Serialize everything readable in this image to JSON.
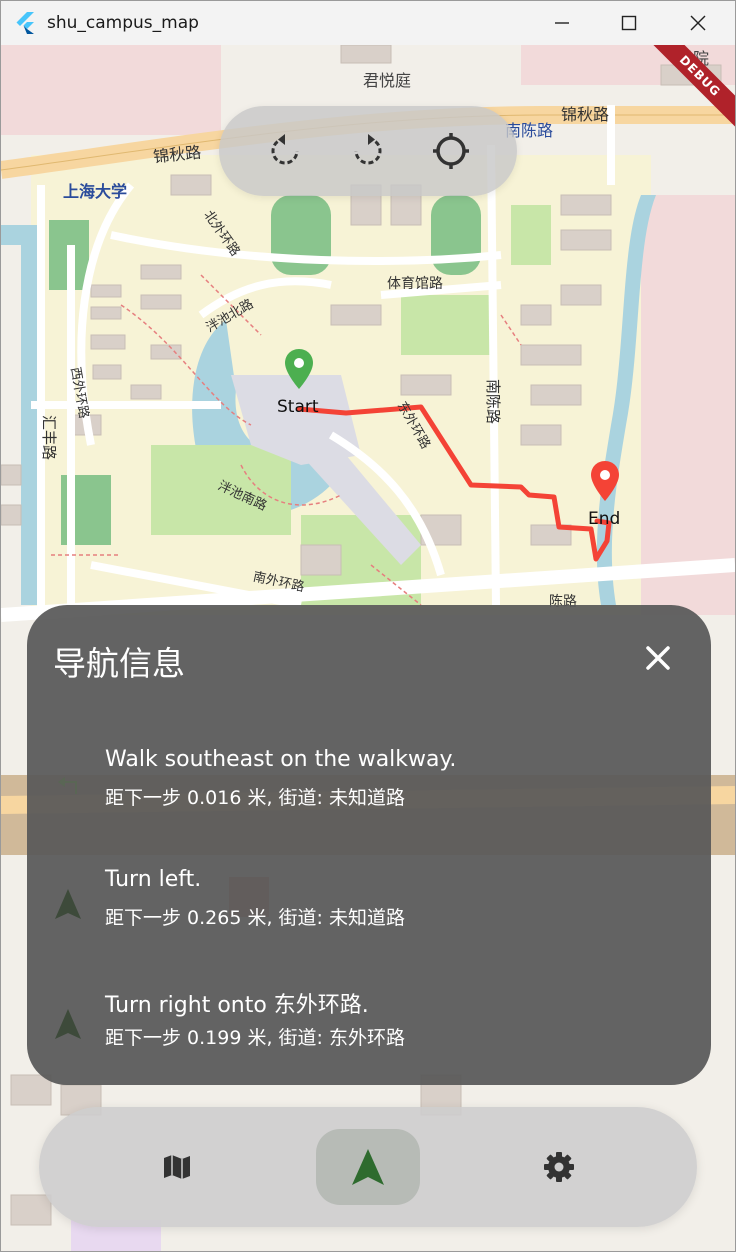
{
  "window": {
    "title": "shu_campus_map",
    "controls": [
      "minimize",
      "maximize",
      "close"
    ]
  },
  "debug_banner": "DEBUG",
  "map": {
    "start_label": "Start",
    "end_label": "End",
    "place_labels": [
      {
        "text": "君悦庭",
        "color": "#444444"
      },
      {
        "text": "锦秋路",
        "color": "#333333"
      },
      {
        "text": "锦秋路",
        "color": "#333333"
      },
      {
        "text": "上海大学",
        "color": "#2a4b9b"
      },
      {
        "text": "南陈路",
        "color": "#2a4b9b"
      },
      {
        "text": "南陈路",
        "color": "#333333"
      },
      {
        "text": "体育馆路",
        "color": "#333333"
      },
      {
        "text": "北外环路",
        "color": "#333333"
      },
      {
        "text": "东外环路",
        "color": "#333333"
      },
      {
        "text": "泮池北路",
        "color": "#333333"
      },
      {
        "text": "泮池南路",
        "color": "#333333"
      },
      {
        "text": "南外环路",
        "color": "#333333"
      },
      {
        "text": "西外环路",
        "color": "#333333"
      },
      {
        "text": "汇丰路",
        "color": "#333333"
      },
      {
        "text": "陈路",
        "color": "#333333"
      },
      {
        "text": "学院",
        "color": "#444444"
      }
    ],
    "controls": [
      {
        "name": "rotate-left",
        "icon": "rotate-left-icon"
      },
      {
        "name": "rotate-right",
        "icon": "rotate-right-icon"
      },
      {
        "name": "locate",
        "icon": "crosshair-icon"
      }
    ],
    "colors": {
      "route": "#f44336",
      "start_marker": "#4caf50",
      "end_marker": "#f44336",
      "road_major": "#f7d6a0",
      "water": "#aad3df",
      "park": "#c8e6a8",
      "building": "#d9d0c9",
      "sports": "#8ac58e"
    }
  },
  "nav_panel": {
    "title": "导航信息",
    "close_icon": "close-icon",
    "steps": [
      {
        "icon": "turn-left-arrow-icon",
        "instruction": "Walk southeast on the walkway.",
        "detail": "距下一步 0.016 米, 街道: 未知道路"
      },
      {
        "icon": "navigation-arrow-icon",
        "instruction": "Turn left.",
        "detail": "距下一步 0.265 米, 街道: 未知道路"
      },
      {
        "icon": "navigation-arrow-icon",
        "instruction": "Turn right onto 东外环路.",
        "detail": "距下一步 0.199 米, 街道: 东外环路"
      }
    ]
  },
  "bottom_nav": {
    "items": [
      {
        "name": "map",
        "icon": "map-icon",
        "selected": false
      },
      {
        "name": "navigation",
        "icon": "navigation-icon",
        "selected": true
      },
      {
        "name": "settings",
        "icon": "gear-icon",
        "selected": false
      }
    ]
  }
}
